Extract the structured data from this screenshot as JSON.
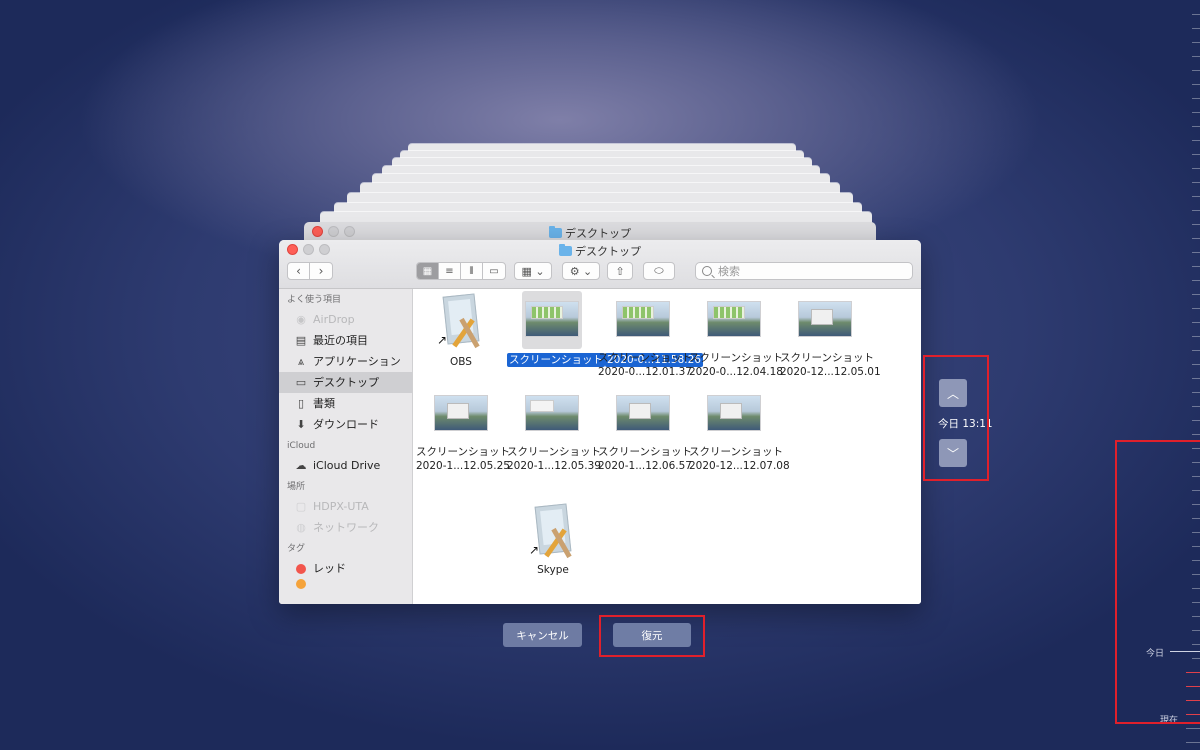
{
  "window": {
    "title": "デスクトップ",
    "back_title": "デスクトップ"
  },
  "toolbar": {
    "back_icon": "chevron-left-icon",
    "forward_icon": "chevron-right-icon",
    "view_modes": [
      "icon-view",
      "list-view",
      "column-view",
      "gallery-view"
    ],
    "group_icon": "group-by-icon",
    "action_icon": "gear-icon",
    "share_icon": "share-icon",
    "tag_icon": "tag-icon",
    "search_placeholder": "検索"
  },
  "sidebar": {
    "favorites_header": "よく使う項目",
    "favorites": [
      {
        "label": "AirDrop",
        "icon": "airdrop-icon",
        "dim": true
      },
      {
        "label": "最近の項目",
        "icon": "recents-icon"
      },
      {
        "label": "アプリケーション",
        "icon": "applications-icon"
      },
      {
        "label": "デスクトップ",
        "icon": "desktop-icon",
        "selected": true
      },
      {
        "label": "書類",
        "icon": "documents-icon"
      },
      {
        "label": "ダウンロード",
        "icon": "downloads-icon"
      }
    ],
    "icloud_header": "iCloud",
    "icloud": [
      {
        "label": "iCloud Drive",
        "icon": "cloud-icon"
      }
    ],
    "locations_header": "場所",
    "locations": [
      {
        "label": "HDPX-UTA",
        "icon": "disk-icon",
        "dim": true
      },
      {
        "label": "ネットワーク",
        "icon": "network-icon",
        "dim": true
      }
    ],
    "tags_header": "タグ",
    "tags": [
      {
        "label": "レッド",
        "color": "#f2554c"
      }
    ]
  },
  "files": [
    {
      "line1": "OBS",
      "line2": "",
      "kind": "alias-app"
    },
    {
      "line1": "スクリーンショット",
      "line2": "2020-0...11.58.26",
      "kind": "screenshot-green",
      "selected": true
    },
    {
      "line1": "スクリーンショット",
      "line2": "2020-0...12.01.37",
      "kind": "screenshot-green"
    },
    {
      "line1": "スクリーンショット",
      "line2": "2020-0...12.04.18",
      "kind": "screenshot-green"
    },
    {
      "line1": "スクリーンショット",
      "line2": "2020-12...12.05.01",
      "kind": "screenshot-window"
    },
    {
      "line1": "スクリーンショット",
      "line2": "2020-1...12.05.25",
      "kind": "screenshot-window"
    },
    {
      "line1": "スクリーンショット",
      "line2": "2020-1...12.05.39",
      "kind": "screenshot-window"
    },
    {
      "line1": "スクリーンショット",
      "line2": "2020-1...12.06.57",
      "kind": "screenshot-window"
    },
    {
      "line1": "スクリーンショット",
      "line2": "2020-12...12.07.08",
      "kind": "screenshot-window"
    },
    {
      "line1": "Skype",
      "line2": "",
      "kind": "alias-app"
    }
  ],
  "time_machine": {
    "up_icon": "chevron-up-icon",
    "down_icon": "chevron-down-icon",
    "current_time": "今日 13:11",
    "cancel_label": "キャンセル",
    "restore_label": "復元",
    "timeline_today": "今日",
    "timeline_now": "現在"
  },
  "colors": {
    "highlight": "#e0202b",
    "selection": "#1b65d3",
    "button": "#6e7ba3"
  }
}
